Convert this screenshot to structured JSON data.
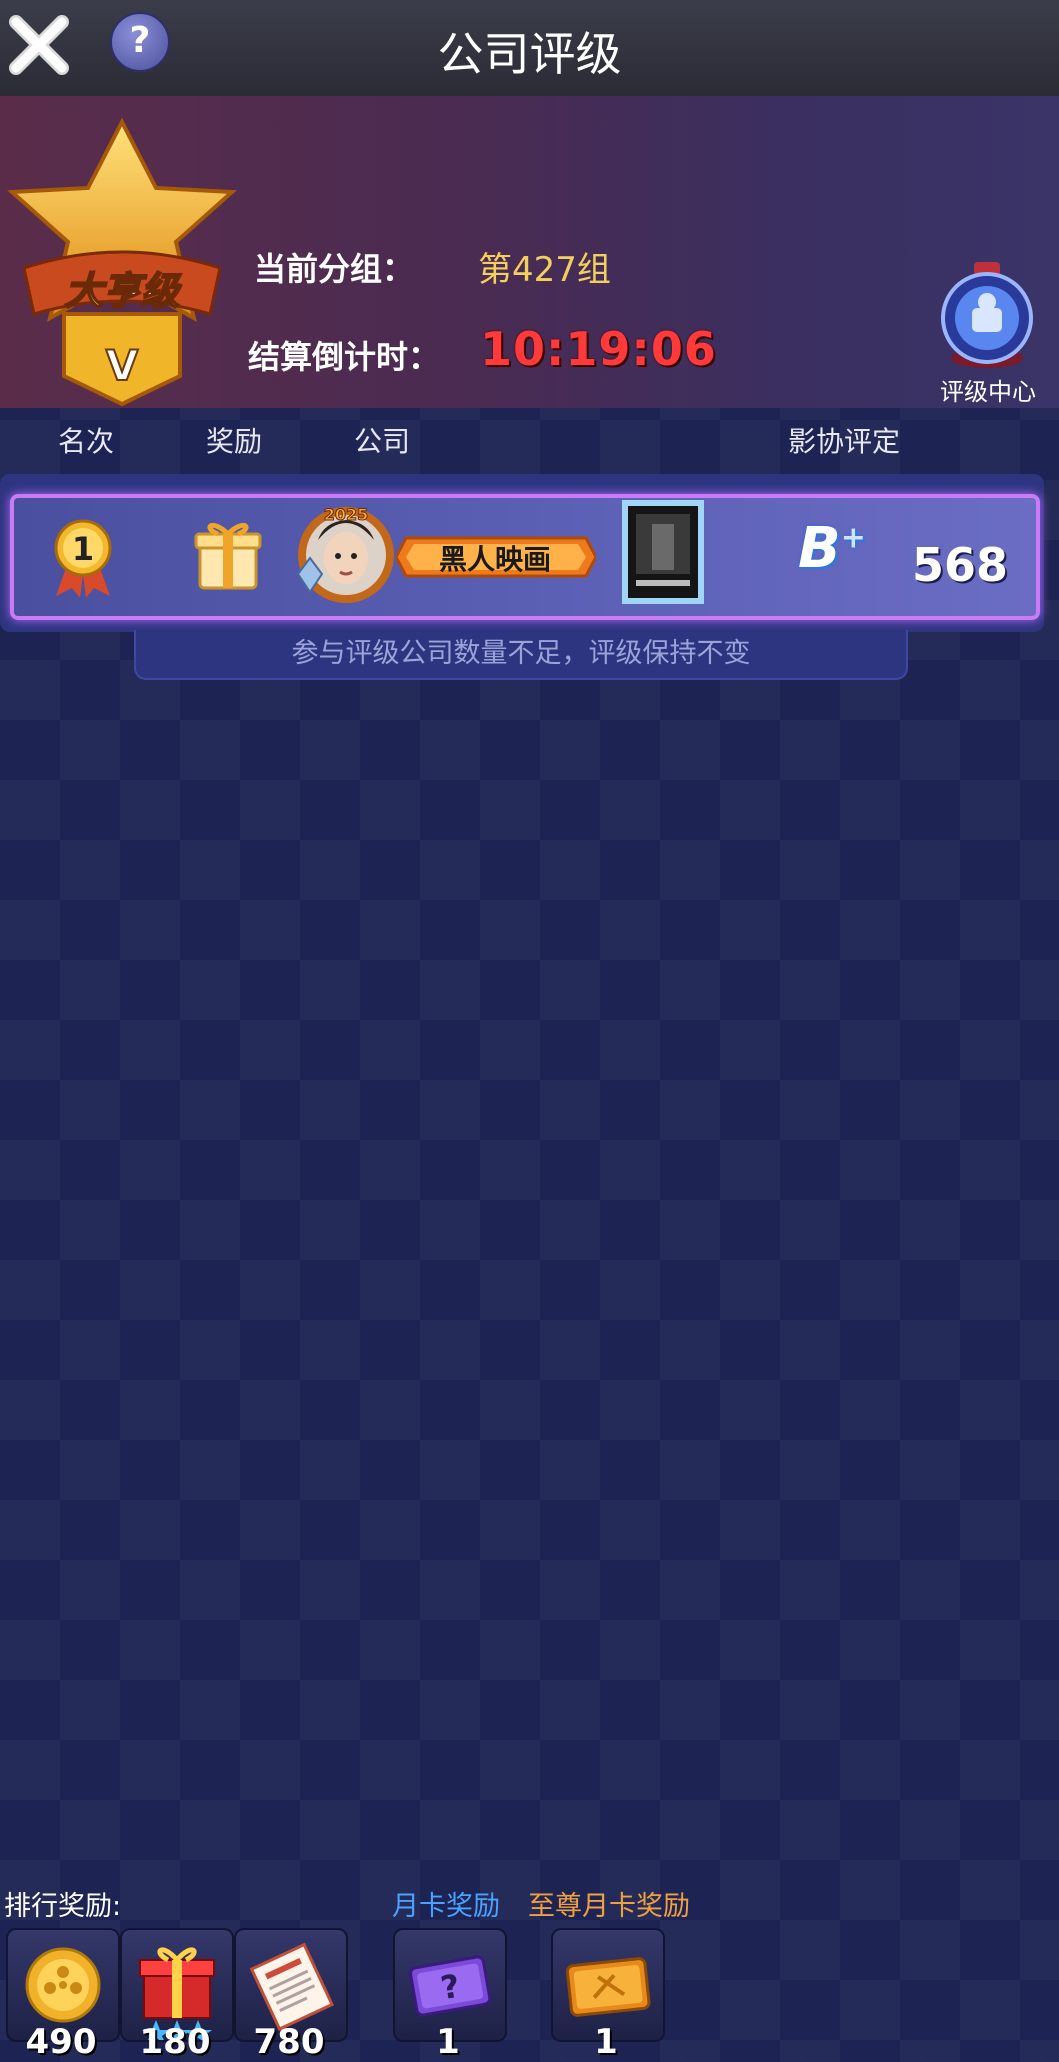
{
  "header": {
    "title": "公司评级"
  },
  "group": {
    "label": "当前分组：",
    "value": "第427组"
  },
  "countdown": {
    "label": "结算倒计时：",
    "value": "10:19:06"
  },
  "level_badge": {
    "name": "大亨级",
    "tier": "V"
  },
  "rating_center": {
    "label": "评级中心"
  },
  "columns": [
    "名次",
    "奖励",
    "公司",
    "影协评定"
  ],
  "rank_row": {
    "rank": "1",
    "avatar_badge": "2025",
    "company": "黑人映画",
    "grade": "B",
    "grade_mod": "+",
    "score": "568"
  },
  "notice": "参与评级公司数量不足，评级保持不变",
  "rewards": {
    "rank_label": "排行奖励:",
    "month_label": "月卡奖励",
    "supreme_label": "至尊月卡奖励",
    "rank_items": [
      {
        "icon": "coin-icon",
        "count": "490"
      },
      {
        "icon": "gift-box-icon",
        "count": "180"
      },
      {
        "icon": "contract-icon",
        "count": "780"
      }
    ],
    "month_items": [
      {
        "icon": "mystery-card-icon",
        "count": "1"
      }
    ],
    "supreme_items": [
      {
        "icon": "gold-card-icon",
        "count": "1"
      }
    ]
  },
  "colors": {
    "countdown": "#ff3a3a",
    "group_value": "#f3cf5e",
    "month_label": "#4aa2ff",
    "supreme_label": "#f0a040",
    "row_border": "#c87bf2"
  }
}
